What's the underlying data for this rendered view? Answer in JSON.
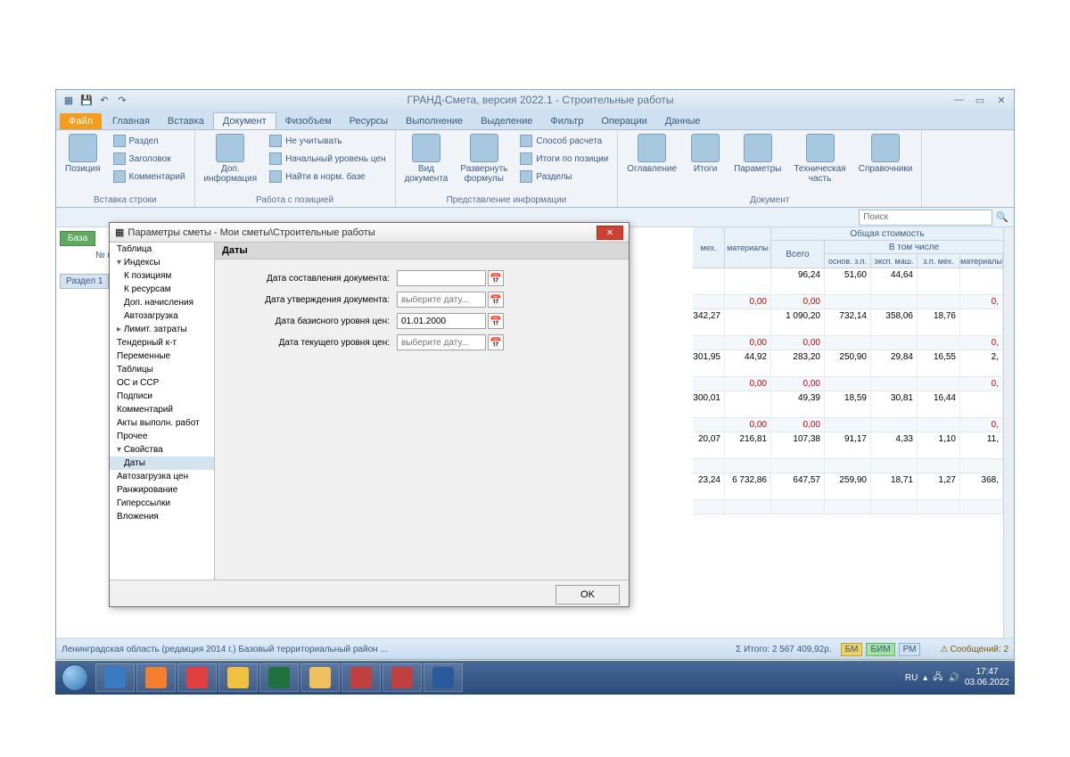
{
  "window": {
    "title": "ГРАНД-Смета, версия 2022.1 - Строительные работы",
    "tabs": [
      "Файл",
      "Главная",
      "Вставка",
      "Документ",
      "Физобъем",
      "Ресурсы",
      "Выполнение",
      "Выделение",
      "Фильтр",
      "Операции",
      "Данные"
    ],
    "active_tab": "Документ",
    "qat_icons": [
      "app-icon",
      "save-icon",
      "undo-icon",
      "redo-icon"
    ],
    "win_btns": [
      "minimize",
      "restore",
      "close"
    ]
  },
  "ribbon": {
    "groups": [
      {
        "title": "Вставка строки",
        "big": [
          {
            "id": "pozitsiya",
            "label": "Позиция"
          }
        ],
        "small": [
          {
            "id": "razdel",
            "label": "Раздел"
          },
          {
            "id": "zagolovok",
            "label": "Заголовок"
          },
          {
            "id": "komment",
            "label": "Комментарий"
          }
        ]
      },
      {
        "title": "Работа с позицией",
        "big": [
          {
            "id": "dopinfo",
            "label": "Доп.\nинформация"
          }
        ],
        "small": [
          {
            "id": "neuchit",
            "label": "Не учитывать"
          },
          {
            "id": "nachur",
            "label": "Начальный уровень цен"
          },
          {
            "id": "naytinorm",
            "label": "Найти в норм. базе"
          }
        ]
      },
      {
        "title": "Представление информации",
        "big": [
          {
            "id": "viddok",
            "label": "Вид\nдокумента"
          },
          {
            "id": "razvf",
            "label": "Развернуть\nформулы"
          }
        ],
        "small": [
          {
            "id": "sposob",
            "label": "Способ расчета"
          },
          {
            "id": "itogipoz",
            "label": "Итоги по позиции"
          },
          {
            "id": "razdely",
            "label": "Разделы"
          }
        ]
      },
      {
        "title": "Документ",
        "big": [
          {
            "id": "oglav",
            "label": "Оглавление"
          },
          {
            "id": "itogi",
            "label": "Итоги"
          },
          {
            "id": "param",
            "label": "Параметры"
          },
          {
            "id": "tech",
            "label": "Техническая\nчасть"
          },
          {
            "id": "sprav",
            "label": "Справочники"
          }
        ],
        "small": []
      }
    ]
  },
  "search_placeholder": "Поиск",
  "baza_btn": "База",
  "row_hdr": {
    "num": "№\nп.п"
  },
  "section1": "Раздел 1",
  "grid": {
    "top": "Общая стоимость",
    "mid": [
      "Всего",
      "В том числе"
    ],
    "cols": [
      "мех.",
      "материалы",
      "",
      "основ. з.п.",
      "эксп. маш.",
      "з.п. мех.",
      "материалы"
    ],
    "widths": [
      36,
      52,
      60,
      52,
      52,
      48,
      48
    ],
    "rows": [
      {
        "thin": false,
        "cells": [
          "",
          "",
          "96,24",
          "51,60",
          "44,64",
          "",
          ""
        ]
      },
      {
        "thin": true,
        "cells": [
          "",
          "0,00",
          "0,00",
          "",
          "",
          "",
          "0,"
        ],
        "red": [
          1,
          2,
          6
        ]
      },
      {
        "thin": false,
        "cells": [
          "342,27",
          "",
          "1 090,20",
          "732,14",
          "358,06",
          "18,76",
          ""
        ]
      },
      {
        "thin": true,
        "cells": [
          "",
          "0,00",
          "0,00",
          "",
          "",
          "",
          "0,"
        ],
        "red": [
          1,
          2,
          6
        ]
      },
      {
        "thin": false,
        "cells": [
          "301,95",
          "44,92",
          "283,20",
          "250,90",
          "29,84",
          "16,55",
          "2,"
        ]
      },
      {
        "thin": true,
        "cells": [
          "",
          "0,00",
          "0,00",
          "",
          "",
          "",
          "0,"
        ],
        "red": [
          1,
          2,
          6
        ]
      },
      {
        "thin": false,
        "cells": [
          "300,01",
          "",
          "49,39",
          "18,59",
          "30,81",
          "16,44",
          ""
        ]
      },
      {
        "thin": true,
        "cells": [
          "",
          "0,00",
          "0,00",
          "",
          "",
          "",
          "0,"
        ],
        "red": [
          1,
          2,
          6
        ]
      },
      {
        "thin": false,
        "cells": [
          "20,07",
          "216,81",
          "107,38",
          "91,17",
          "4,33",
          "1,10",
          "11,"
        ]
      },
      {
        "thin": true,
        "cells": [
          "",
          "",
          "",
          "",
          "",
          "",
          ""
        ]
      },
      {
        "thin": false,
        "cells": [
          "23,24",
          "6 732,86",
          "647,57",
          "259,90",
          "18,71",
          "1,27",
          "368,"
        ]
      },
      {
        "thin": true,
        "cells": [
          "",
          "",
          "",
          "",
          "",
          "",
          ""
        ]
      }
    ]
  },
  "dialog": {
    "title": "Параметры сметы - Мои сметы\\Строительные работы",
    "tree": [
      {
        "l": 1,
        "t": "Таблица"
      },
      {
        "l": 1,
        "t": "Индексы",
        "exp": true
      },
      {
        "l": 2,
        "t": "К позициям"
      },
      {
        "l": 2,
        "t": "К ресурсам"
      },
      {
        "l": 2,
        "t": "Доп. начисления"
      },
      {
        "l": 2,
        "t": "Автозагрузка"
      },
      {
        "l": 1,
        "t": "Лимит. затраты",
        "col": true
      },
      {
        "l": 1,
        "t": "Тендерный к-т"
      },
      {
        "l": 1,
        "t": "Переменные"
      },
      {
        "l": 1,
        "t": "Таблицы"
      },
      {
        "l": 1,
        "t": "ОС и ССР"
      },
      {
        "l": 1,
        "t": "Подписи"
      },
      {
        "l": 1,
        "t": "Комментарий"
      },
      {
        "l": 1,
        "t": "Акты выполн. работ"
      },
      {
        "l": 1,
        "t": "Прочее"
      },
      {
        "l": 1,
        "t": "Свойства",
        "exp": true
      },
      {
        "l": 2,
        "t": "Даты",
        "sel": true
      },
      {
        "l": 1,
        "t": "Автозагрузка цен"
      },
      {
        "l": 1,
        "t": "Ранжирование"
      },
      {
        "l": 1,
        "t": "Гиперссылки"
      },
      {
        "l": 1,
        "t": "Вложения"
      }
    ],
    "section": "Даты",
    "fields": [
      {
        "label": "Дата составления документа:",
        "value": "",
        "ph": ""
      },
      {
        "label": "Дата утверждения документа:",
        "value": "",
        "ph": "выберите дату..."
      },
      {
        "label": "Дата базисного уровня цен:",
        "value": "01.01.2000",
        "ph": ""
      },
      {
        "label": "Дата текущего уровня цен:",
        "value": "",
        "ph": "выберите дату..."
      }
    ],
    "ok": "OK"
  },
  "statusbar": {
    "left": "Ленинградская область (редакция 2014 г.)   Базовый территориальный район   ...",
    "total": "Σ Итого: 2 567 409,92р.",
    "badges": [
      "БМ",
      "БИМ",
      "РМ"
    ],
    "msg": "Сообщений: 2"
  },
  "taskbar": {
    "items": [
      "ie",
      "media",
      "opera",
      "chrome",
      "excel",
      "explorer",
      "app1",
      "app2",
      "word"
    ],
    "lang": "RU",
    "time": "17:47",
    "date": "03.06.2022"
  }
}
